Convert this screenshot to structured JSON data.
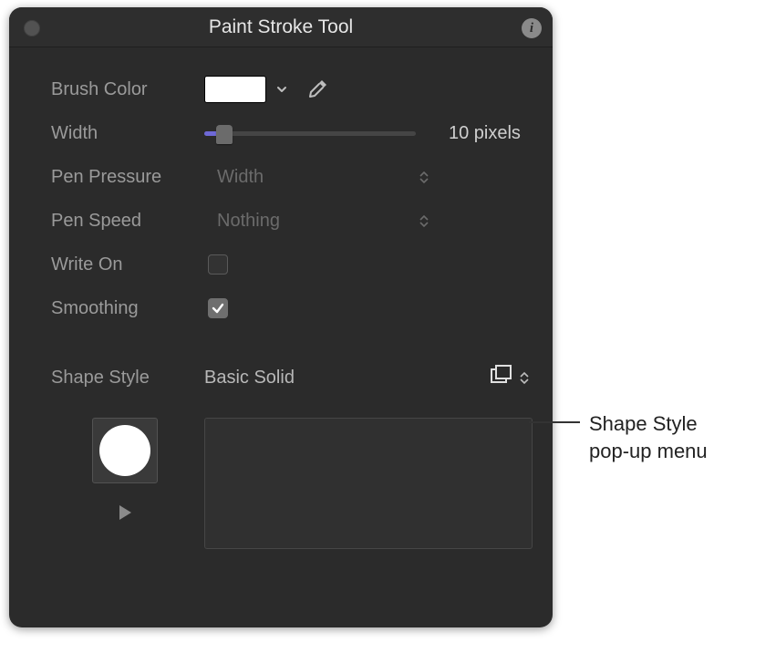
{
  "window": {
    "title": "Paint Stroke Tool"
  },
  "labels": {
    "brush_color": "Brush Color",
    "width": "Width",
    "pen_pressure": "Pen Pressure",
    "pen_speed": "Pen Speed",
    "write_on": "Write On",
    "smoothing": "Smoothing",
    "shape_style": "Shape Style"
  },
  "values": {
    "brush_color": "#FFFFFF",
    "width_display": "10 pixels",
    "pen_pressure": "Width",
    "pen_speed": "Nothing",
    "write_on": false,
    "smoothing": true,
    "shape_style": "Basic Solid"
  },
  "callout": "Shape Style\npop-up menu",
  "colors": {
    "accent": "#6e69d6",
    "panel_bg": "#2b2b2b",
    "text_dim": "#9a9a9a",
    "text_bright": "#cfcfcf"
  }
}
